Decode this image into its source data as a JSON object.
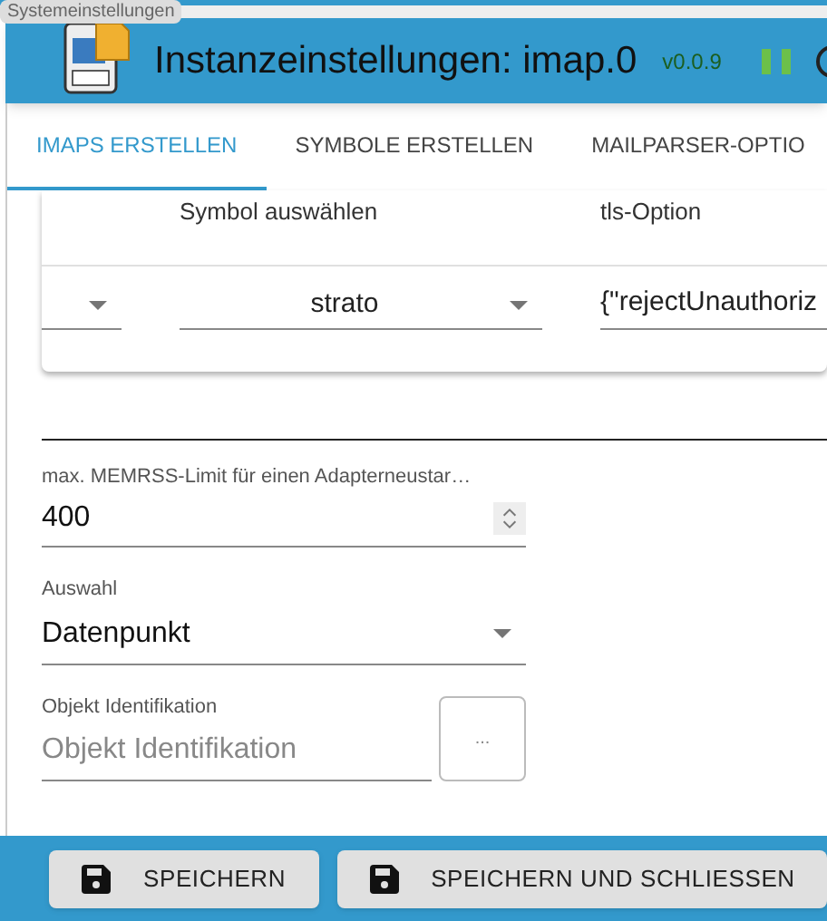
{
  "tooltip": "Systemeinstellungen",
  "header": {
    "title": "Instanzeinstellungen: imap.0",
    "version": "v0.0.9",
    "running": true
  },
  "tabs": [
    {
      "label": "IMAPS ERSTELLEN",
      "selected": true
    },
    {
      "label": "SYMBOLE ERSTELLEN",
      "selected": false
    },
    {
      "label": "MAILPARSER-OPTIO",
      "selected": false
    }
  ],
  "table": {
    "columns": [
      "Symbol auswählen",
      "tls-Option"
    ],
    "rows": [
      {
        "symbol": "strato",
        "tls_option": "{\"rejectUnauthoriz"
      }
    ]
  },
  "fields": [
    {
      "kind": "number",
      "label": "max. MEMRSS-Limit für einen Adapterneustar…",
      "value": "400"
    },
    {
      "kind": "select",
      "label": "Auswahl",
      "value": "Datenpunkt"
    },
    {
      "kind": "object",
      "label": "Objekt Identifikation",
      "placeholder": "Objekt Identifikation",
      "button": "..."
    }
  ],
  "buttons": [
    "SPEICHERN",
    "SPEICHERN UND SCHLIESSEN"
  ]
}
